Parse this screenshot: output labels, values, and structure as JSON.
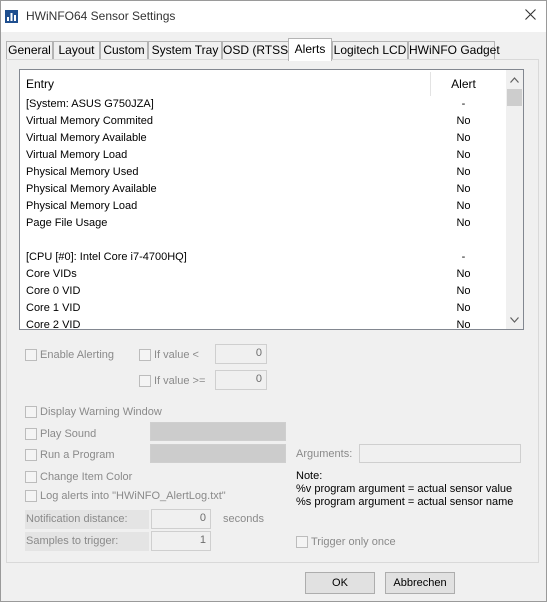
{
  "window": {
    "title": "HWiNFO64 Sensor Settings"
  },
  "tabs": [
    {
      "label": "General"
    },
    {
      "label": "Layout"
    },
    {
      "label": "Custom"
    },
    {
      "label": "System Tray"
    },
    {
      "label": "OSD (RTSS)"
    },
    {
      "label": "Alerts"
    },
    {
      "label": "Logitech LCD"
    },
    {
      "label": "HWiNFO Gadget"
    }
  ],
  "active_tab": "Alerts",
  "list": {
    "col_entry": "Entry",
    "col_alert": "Alert",
    "rows": [
      {
        "entry": "[System: ASUS G750JZA]",
        "alert": "-"
      },
      {
        "entry": "Virtual Memory Commited",
        "alert": "No"
      },
      {
        "entry": "Virtual Memory Available",
        "alert": "No"
      },
      {
        "entry": "Virtual Memory Load",
        "alert": "No"
      },
      {
        "entry": "Physical Memory Used",
        "alert": "No"
      },
      {
        "entry": "Physical Memory Available",
        "alert": "No"
      },
      {
        "entry": "Physical Memory Load",
        "alert": "No"
      },
      {
        "entry": "Page File Usage",
        "alert": "No"
      },
      {
        "entry": "",
        "alert": ""
      },
      {
        "entry": "[CPU [#0]: Intel Core i7-4700HQ]",
        "alert": "-"
      },
      {
        "entry": "Core VIDs",
        "alert": "No"
      },
      {
        "entry": "Core 0 VID",
        "alert": "No"
      },
      {
        "entry": "Core 1 VID",
        "alert": "No"
      },
      {
        "entry": "Core 2 VID",
        "alert": "No"
      }
    ]
  },
  "alerting": {
    "enable_label": "Enable Alerting",
    "if_value_lt_label": "If value  <",
    "if_value_lt_value": "0",
    "if_value_gte_label": "If value >=",
    "if_value_gte_value": "0"
  },
  "actions": {
    "display_warning_label": "Display Warning Window",
    "play_sound_label": "Play Sound",
    "run_program_label": "Run a Program",
    "arguments_label": "Arguments:",
    "change_color_label": "Change Item Color",
    "log_alerts_label": "Log alerts into \"HWiNFO_AlertLog.txt\""
  },
  "note": {
    "title": "Note:",
    "line1": "%v program argument = actual sensor value",
    "line2": "%s program argument = actual sensor name"
  },
  "notification": {
    "distance_label": "Notification distance:",
    "distance_value": "0",
    "distance_unit": "seconds",
    "samples_label": "Samples to trigger:",
    "samples_value": "1",
    "trigger_once_label": "Trigger only once"
  },
  "buttons": {
    "ok": "OK",
    "cancel": "Abbrechen"
  },
  "colors": {
    "dialog_bg": "#f0f0f0",
    "list_border": "#828790",
    "disabled_text": "#8a8a8a"
  },
  "icons": {
    "app": "hwinfo-app-icon",
    "close": "close-icon",
    "scroll_up": "chevron-up-icon",
    "scroll_down": "chevron-down-icon"
  }
}
